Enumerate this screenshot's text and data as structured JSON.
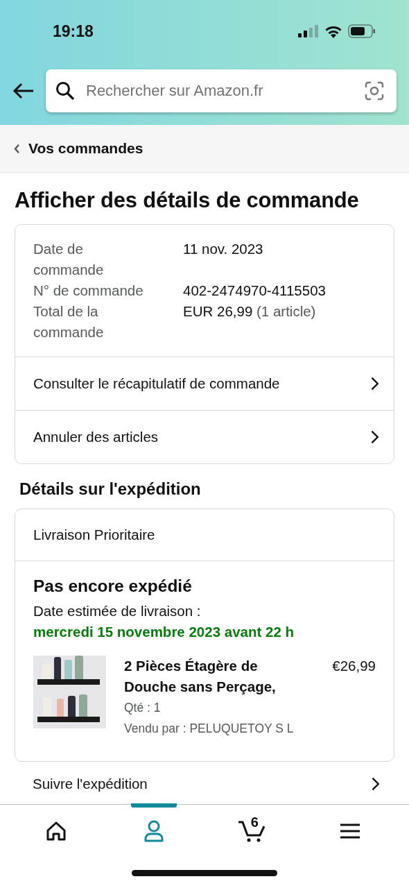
{
  "status_bar": {
    "time": "19:18"
  },
  "search": {
    "placeholder": "Rechercher sur Amazon.fr"
  },
  "breadcrumb": {
    "label": "Vos commandes"
  },
  "page_title": "Afficher des détails de commande",
  "order_info": [
    {
      "label": "Date de commande",
      "value": "11 nov. 2023"
    },
    {
      "label": "N° de commande",
      "value": "402-2474970-4115503"
    },
    {
      "label": "Total de la commande",
      "value": "EUR 26,99",
      "note": "(1 article)"
    }
  ],
  "order_links": [
    "Consulter le récapitulatif de commande",
    "Annuler des articles"
  ],
  "shipping": {
    "title": "Détails sur l'expédition",
    "method": "Livraison Prioritaire",
    "status": "Pas encore expédié",
    "estimate_label": "Date estimée de livraison :",
    "estimate_date": "mercredi 15 novembre 2023 avant 22 h",
    "item": {
      "kind": "picture",
      "name": "2 Pièces Étagère de Douche sans Perçage,",
      "price": "€26,99",
      "quantity": "Qté : 1",
      "seller": "Vendu par : PELUQUETOY S L"
    },
    "track_link": "Suivre l'expédition"
  },
  "nav": [
    {
      "kind": "home",
      "selected": false
    },
    {
      "kind": "account",
      "selected": true
    },
    {
      "kind": "cart",
      "selected": false,
      "count": "6"
    },
    {
      "kind": "menu",
      "selected": false
    }
  ]
}
